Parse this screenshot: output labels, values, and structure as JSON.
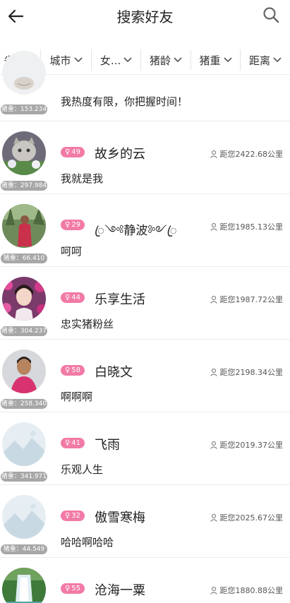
{
  "header": {
    "title": "搜索好友"
  },
  "filters": [
    {
      "label": "省份"
    },
    {
      "label": "城市"
    },
    {
      "label": "女..."
    },
    {
      "label": "猪龄"
    },
    {
      "label": "猪重"
    },
    {
      "label": "距离"
    }
  ],
  "rows": [
    {
      "weight": "猪重：153.234",
      "age": "",
      "name": "",
      "distance": "",
      "signature": "我热度有限，你把握时间！",
      "avatar": "partial-photo"
    },
    {
      "weight": "猪重：297.984",
      "age": "49",
      "name": "故乡的云",
      "distance": "距您2422.68公里",
      "signature": "我就是我",
      "avatar": "cat-photo"
    },
    {
      "weight": "猪重：66.410",
      "age": "29",
      "name": "ꦿ༺静波༻ꦿ",
      "distance": "距您1985.13公里",
      "signature": "呵呵",
      "avatar": "woman-outdoor"
    },
    {
      "weight": "猪重：304.237",
      "age": "44",
      "name": "乐享生活",
      "distance": "距您1987.72公里",
      "signature": "忠实猪粉丝",
      "avatar": "woman-flowers"
    },
    {
      "weight": "猪重：258.340",
      "age": "58",
      "name": "白晓文",
      "distance": "距您2198.34公里",
      "signature": "啊啊啊",
      "avatar": "woman-pink"
    },
    {
      "weight": "猪重：341.971",
      "age": "41",
      "name": "飞雨",
      "distance": "距您2019.37公里",
      "signature": "乐观人生",
      "avatar": "default-landscape"
    },
    {
      "weight": "猪重：44.549",
      "age": "32",
      "name": "傲雪寒梅",
      "distance": "距您2025.67公里",
      "signature": "哈哈啊哈哈",
      "avatar": "default-landscape"
    },
    {
      "weight": "",
      "age": "55",
      "name": "沧海一粟",
      "distance": "距您1880.88公里",
      "signature": "",
      "avatar": "waterfall-photo"
    }
  ]
}
